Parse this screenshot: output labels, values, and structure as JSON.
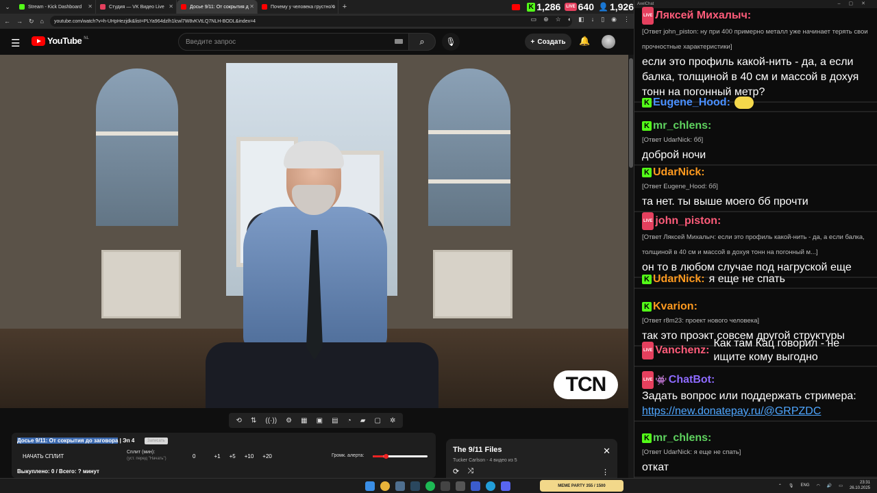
{
  "browser": {
    "tabs": [
      {
        "title": "Stream - Kick Dashboard",
        "color": "#53fc18"
      },
      {
        "title": "Студия — VK Видео Live",
        "color": "#e5405e"
      },
      {
        "title": "Досье 9/11: От сокрытия д",
        "color": "#ff0000",
        "active": true
      },
      {
        "title": "Почему у человека грустно о",
        "color": "#ff0000"
      }
    ],
    "url": "youtube.com/watch?v=h-UHpHezjdk&list=PLYa964dzlh1lcwl7W8vKVtLQ7NLH-BODL&index=4"
  },
  "counters": {
    "kick": "1,286",
    "vk": "640",
    "viewers": "1,926"
  },
  "youtube": {
    "logo_text": "YouTube",
    "region": "NL",
    "search_placeholder": "Введите запрос",
    "create_label": "Создать"
  },
  "video": {
    "watermark": "TCN"
  },
  "panel": {
    "title_highlight": "Досье 9/11: От сокрытия до заговора",
    "title_rest": " | Эп 4",
    "badge": "Записать",
    "start_label": "НАЧАТЬ СПЛИТ",
    "split_label": "Сплит (мин):",
    "split_hint": "(уст. перед \"Начать\")",
    "split_value": "0",
    "increments": [
      "+1",
      "+5",
      "+10",
      "+20"
    ],
    "volume_label": "Громк. алерта:",
    "volume_level": 0.2,
    "footer": "Выкуплено: 0 / Всего: ? минут"
  },
  "playlist": {
    "title": "The 9/11 Files",
    "subtitle": "Tucker Carlson - 4 видео из 5"
  },
  "chat": {
    "window_title": "AxelChat",
    "messages": [
      {
        "platform": "vk",
        "user": "Ляксей Михалыч:",
        "color": "#ff5c7a",
        "reply": "[Ответ john_piston: ну при 400 примерно металл уже начинает терять свои прочностные характеристики]",
        "text": "если это профиль какой-нить - да, а если балка, толщиной в 40 см и массой в дохуя тонн на погонный метр?"
      },
      {
        "platform": "kick",
        "user": "Eugene_Hood:",
        "color": "#4a90ff",
        "emoji": true
      },
      {
        "platform": "kick",
        "user": "mr_chlens:",
        "color": "#5fd35f",
        "reply": "[Ответ UdarNick: бб]",
        "text": "доброй ночи"
      },
      {
        "platform": "kick",
        "user": "UdarNick:",
        "color": "#ff9a1f",
        "reply": "[Ответ Eugene_Hood: бб]",
        "text": "та нет. ты выше моего бб прочти"
      },
      {
        "platform": "vk",
        "user": "john_piston:",
        "color": "#ff5c7a",
        "reply": "[Ответ Ляксей Михалыч: если это профиль какой-нить - да, а если балка, толщиной в 40 см и массой в дохуя тонн на погонный м...]",
        "text": "он то в любом случае под нагруской еще"
      },
      {
        "platform": "kick",
        "user": "UdarNick:",
        "color": "#ff9a1f",
        "inline": "я еще не спать"
      },
      {
        "platform": "kick",
        "user": "Kvarion:",
        "color": "#ff9a1f",
        "reply": "[Ответ r8m23: проект нового человека]",
        "text": "так это проэкт совсем другой структуры"
      },
      {
        "platform": "vk",
        "user": "Vanchenz:",
        "color": "#ff5c7a",
        "inline": "Как там Кац говорил - не ищите кому выгодно"
      },
      {
        "platform": "vk",
        "user": "ChatBot:",
        "color": "#8e6bff",
        "bot": true,
        "text": "Задать вопрос или поддержать стримера:",
        "link": "https://new.donatepay.ru/@GRPZDC"
      },
      {
        "platform": "kick",
        "user": "mr_chlens:",
        "color": "#5fd35f",
        "reply": "[Ответ UdarNick: я еще не спать]",
        "text": "откат"
      }
    ]
  },
  "taskbar": {
    "meme_widget": "MEME PARTY  355 / 1500",
    "lang": "ENG",
    "time": "23:31",
    "date": "26.10.2025"
  }
}
